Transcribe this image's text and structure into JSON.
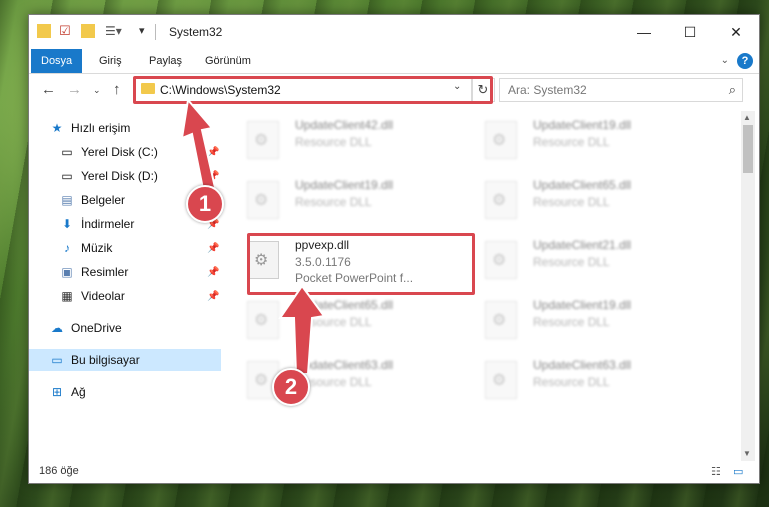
{
  "window": {
    "title": "System32",
    "controls": {
      "minimize": "—",
      "maximize": "☐",
      "close": "✕"
    }
  },
  "ribbon": {
    "tabs": [
      {
        "label": "Dosya",
        "active": true
      },
      {
        "label": "Giriş",
        "active": false
      },
      {
        "label": "Paylaş",
        "active": false
      },
      {
        "label": "Görünüm",
        "active": false
      }
    ],
    "help": "?"
  },
  "address": {
    "path": "C:\\Windows\\System32",
    "search_placeholder": "Ara: System32"
  },
  "nav": {
    "quick_access": "Hızlı erişim",
    "items": [
      {
        "label": "Yerel Disk (C:)",
        "icon": "drive-icon",
        "pinned": true
      },
      {
        "label": "Yerel Disk (D:)",
        "icon": "drive-icon",
        "pinned": true
      },
      {
        "label": "Belgeler",
        "icon": "documents-icon",
        "pinned": true
      },
      {
        "label": "İndirmeler",
        "icon": "downloads-icon",
        "pinned": true
      },
      {
        "label": "Müzik",
        "icon": "music-icon",
        "pinned": true
      },
      {
        "label": "Resimler",
        "icon": "pictures-icon",
        "pinned": true
      },
      {
        "label": "Videolar",
        "icon": "videos-icon",
        "pinned": true
      }
    ],
    "onedrive": "OneDrive",
    "this_pc": "Bu bilgisayar",
    "network": "Ağ"
  },
  "files": {
    "left": [
      {
        "name": "UpdateClient42.dll",
        "sub": "Resource DLL"
      },
      {
        "name": "UpdateClient19.dll",
        "sub": "Resource DLL"
      },
      {
        "name": "ppvexp.dll",
        "sub": "3.5.0.1176",
        "sub2": "Pocket PowerPoint f..."
      },
      {
        "name": "UpdateClient65.dll",
        "sub": "Resource DLL"
      },
      {
        "name": "UpdateClient63.dll",
        "sub": "Resource DLL"
      }
    ],
    "right": [
      {
        "name": "UpdateClient19.dll",
        "sub": "Resource DLL"
      },
      {
        "name": "UpdateClient65.dll",
        "sub": "Resource DLL"
      },
      {
        "name": "UpdateClient21.dll",
        "sub": "Resource DLL"
      },
      {
        "name": "UpdateClient19.dll",
        "sub": "Resource DLL"
      },
      {
        "name": "UpdateClient63.dll",
        "sub": "Resource DLL"
      }
    ]
  },
  "status": {
    "count": "186 öğe"
  },
  "annotations": {
    "step1": "1",
    "step2": "2"
  },
  "colors": {
    "accent": "#1979ca",
    "highlight": "#d9474f"
  }
}
